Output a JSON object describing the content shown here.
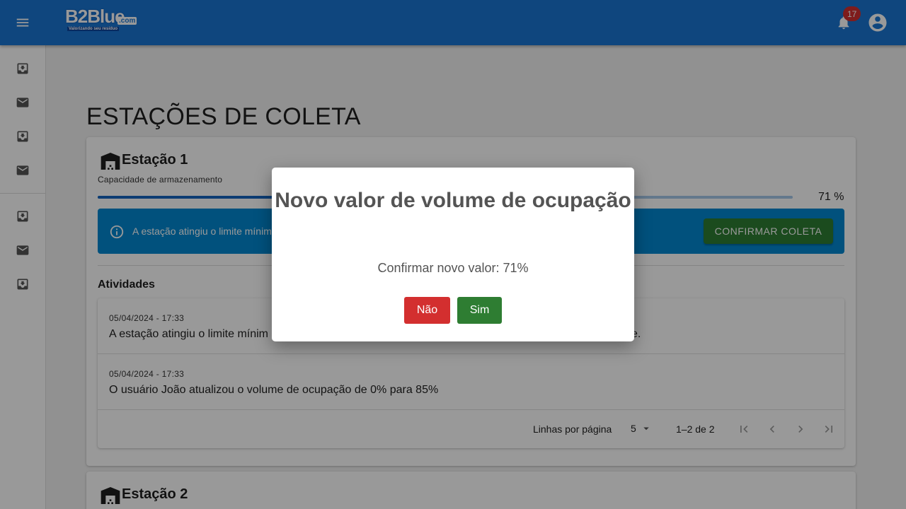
{
  "header": {
    "logo_text": "B2Blue",
    "logo_domain": ".com",
    "logo_slogan": "Valorizando seu resíduo",
    "notifications_count": "17",
    "menu_icon": "menu-icon",
    "bell_icon": "bell-icon",
    "account_icon": "account-circle-icon"
  },
  "sidebar": {
    "items": [
      {
        "icon": "inbox-icon"
      },
      {
        "icon": "mail-icon"
      },
      {
        "icon": "inbox-icon"
      },
      {
        "icon": "mail-icon"
      },
      {
        "icon": "inbox-icon"
      },
      {
        "icon": "mail-icon"
      },
      {
        "icon": "inbox-icon"
      }
    ]
  },
  "page": {
    "title": "ESTAÇÕES DE COLETA"
  },
  "stations": [
    {
      "name": "Estação 1",
      "capacity_label": "Capacidade de armazenamento",
      "progress": 71,
      "progress_text": "71 %",
      "alert_text": "A estação atingiu o limite mínimo",
      "confirm_label": "CONFIRMAR COLETA",
      "activities_title": "Atividades",
      "activities": [
        {
          "date": "05/04/2024 - 17:33",
          "text": "A estação atingiu o limite mínim",
          "text_tail": "e."
        },
        {
          "date": "05/04/2024 - 17:33",
          "text": "O usuário João atualizou o volume de ocupação de 0% para 85%"
        }
      ],
      "pagination": {
        "rows_label": "Linhas por página",
        "rows_value": "5",
        "range": "1–2 de 2"
      }
    },
    {
      "name": "Estação 2"
    }
  ],
  "dialog": {
    "title": "Novo valor de volume de ocupação",
    "text": "Confirmar novo valor: 71%",
    "no_label": "Não",
    "yes_label": "Sim"
  },
  "colors": {
    "primary": "#1976d2",
    "alert_bg": "#0288d1",
    "success": "#2e7d32",
    "danger": "#d32f2f"
  }
}
